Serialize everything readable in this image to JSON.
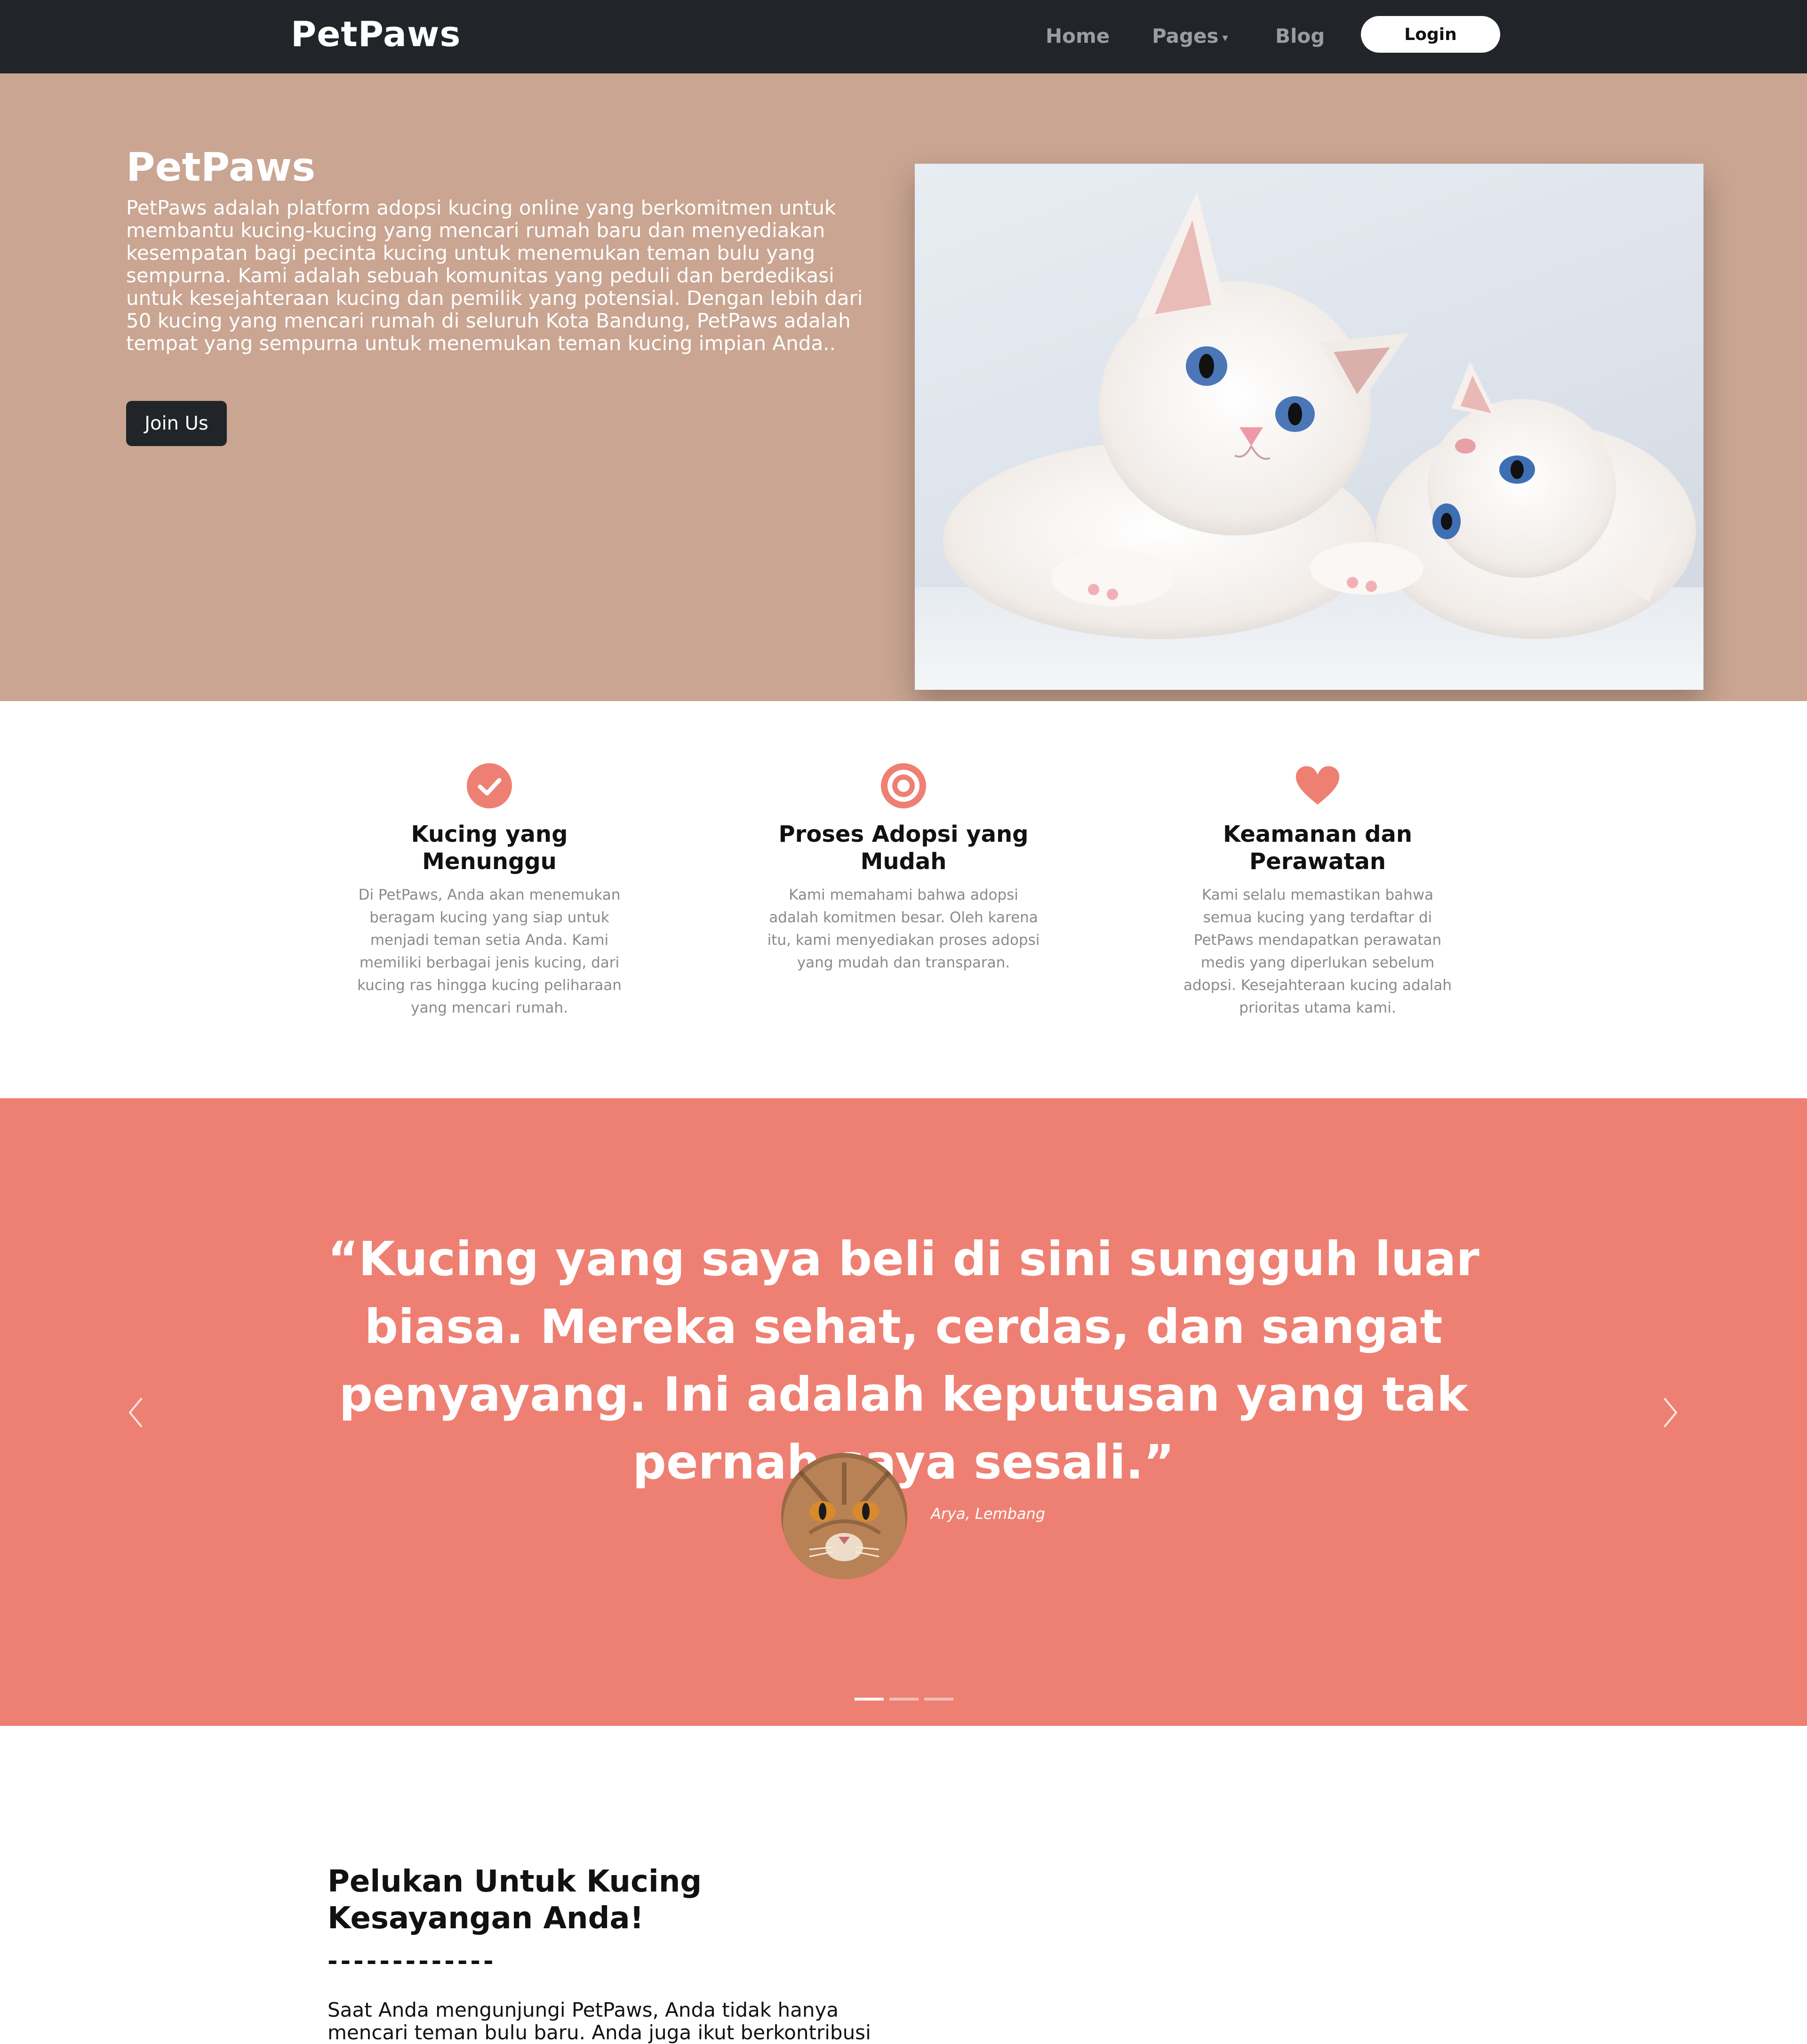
{
  "navbar": {
    "brand": "PetPaws",
    "links": {
      "home": "Home",
      "pages": "Pages",
      "blog": "Blog"
    },
    "login": "Login"
  },
  "hero": {
    "title": "PetPaws",
    "text": "PetPaws adalah platform adopsi kucing online yang berkomitmen untuk membantu kucing-kucing yang mencari rumah baru dan menyediakan kesempatan bagi pecinta kucing untuk menemukan teman bulu yang sempurna. Kami adalah sebuah komunitas yang peduli dan berdedikasi untuk kesejahteraan kucing dan pemilik yang potensial. Dengan lebih dari 50 kucing yang mencari rumah di seluruh Kota Bandung, PetPaws adalah tempat yang sempurna untuk menemukan teman kucing impian Anda..",
    "button": "Join Us",
    "background": "#c9a592"
  },
  "features": [
    {
      "icon": "check-circle-icon",
      "title": "Kucing yang Menunggu",
      "text": "Di PetPaws, Anda akan menemukan beragam kucing yang siap untuk menjadi teman setia Anda. Kami memiliki berbagai jenis kucing, dari kucing ras hingga kucing peliharaan yang mencari rumah."
    },
    {
      "icon": "target-icon",
      "title": "Proses Adopsi yang Mudah",
      "text": "Kami memahami bahwa adopsi adalah komitmen besar. Oleh karena itu, kami menyediakan proses adopsi yang mudah dan transparan."
    },
    {
      "icon": "heart-icon",
      "title": "Keamanan dan Perawatan",
      "text": "Kami selalu memastikan bahwa semua kucing yang terdaftar di PetPaws mendapatkan perawatan medis yang diperlukan sebelum adopsi. Kesejahteraan kucing adalah prioritas utama kami."
    }
  ],
  "testimonial": {
    "quote": "“Kucing yang saya beli di sini sungguh luar biasa. Mereka sehat, cerdas, dan sangat penyayang. Ini adalah keputusan yang tak pernah saya sesali.”",
    "author": "Arya, Lembang",
    "slides": 3,
    "active_slide": 1,
    "background": "#ee8073"
  },
  "about": {
    "title": "Pelukan Untuk Kucing Kesayangan Anda!",
    "divider": "-------------",
    "text": "Saat Anda mengunjungi PetPaws, Anda tidak hanya mencari teman bulu baru. Anda juga ikut berkontribusi"
  },
  "colors": {
    "accent": "#ee8073",
    "dark": "#212529"
  }
}
